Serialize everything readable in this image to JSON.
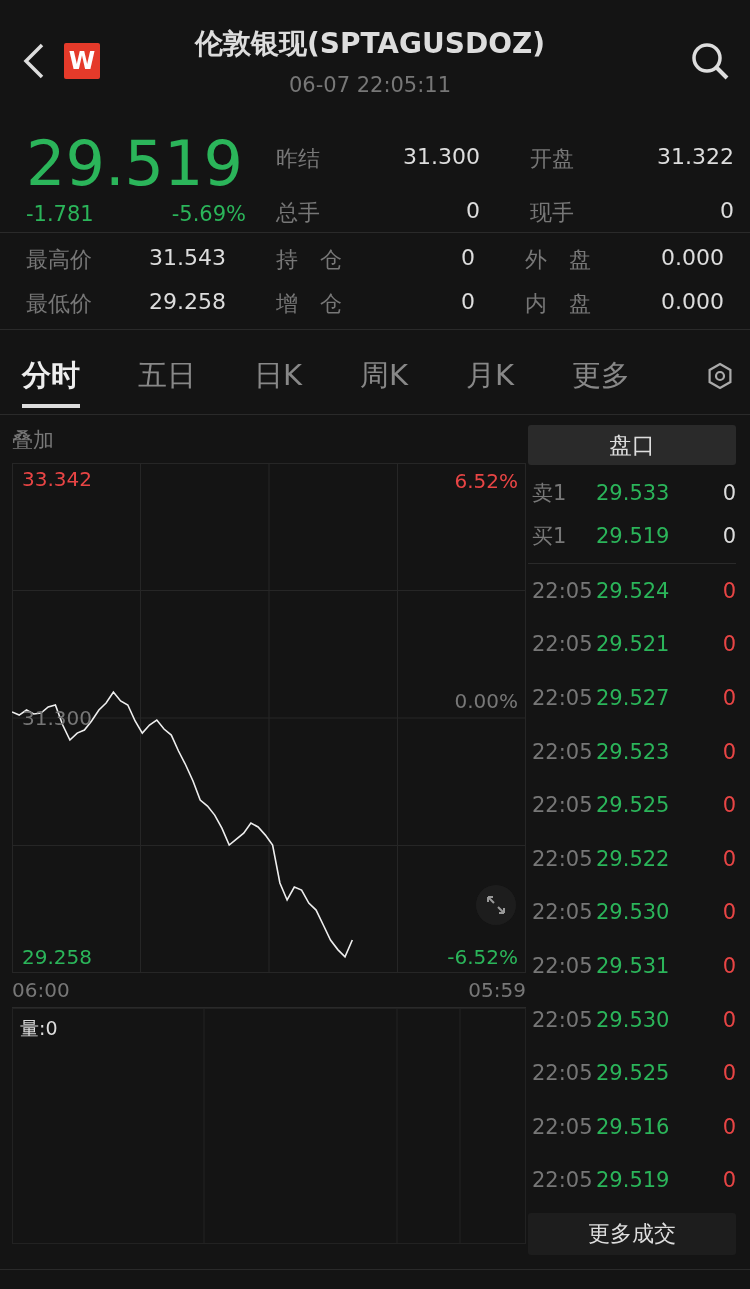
{
  "header": {
    "title": "伦敦银现(SPTAGUSDOZ)",
    "time": "06-07 22:05:11",
    "badge": "W"
  },
  "quote": {
    "price": "29.519",
    "change": "-1.781",
    "change_pct": "-5.69%"
  },
  "stats_top": [
    [
      {
        "label": "昨结",
        "value": "31.300"
      },
      {
        "label": "开盘",
        "value": "31.322"
      }
    ],
    [
      {
        "label": "总手",
        "value": "0"
      },
      {
        "label": "现手",
        "value": "0"
      }
    ]
  ],
  "stats_bottom": [
    [
      {
        "label": "最高价",
        "value": "31.543"
      },
      {
        "label": "持　仓",
        "value": "0"
      },
      {
        "label": "外　盘",
        "value": "0.000"
      }
    ],
    [
      {
        "label": "最低价",
        "value": "29.258"
      },
      {
        "label": "增　仓",
        "value": "0"
      },
      {
        "label": "内　盘",
        "value": "0.000"
      }
    ]
  ],
  "tabs": [
    {
      "label": "分时",
      "selected": true
    },
    {
      "label": "五日",
      "selected": false
    },
    {
      "label": "日K",
      "selected": false
    },
    {
      "label": "周K",
      "selected": false
    },
    {
      "label": "月K",
      "selected": false
    },
    {
      "label": "更多",
      "selected": false
    }
  ],
  "chart": {
    "overlay_label": "叠加",
    "y_top_pct": "6.52%",
    "y_mid_pct": "0.00%",
    "y_bottom_pct": "-6.52%",
    "volume_label": "量:0",
    "x_start": "06:00",
    "x_end": "05:59",
    "chart_data": {
      "type": "line",
      "ylim": [
        29.12,
        33.48
      ],
      "categories": [
        null,
        null,
        null,
        null,
        null,
        null,
        null,
        null,
        null,
        null,
        null,
        null,
        null,
        null,
        null,
        null,
        null,
        null,
        null,
        null,
        null,
        null,
        null,
        null,
        null,
        null,
        null,
        null,
        null,
        null,
        null,
        null,
        null,
        null,
        null,
        null,
        null,
        null,
        null,
        null,
        null,
        null,
        null,
        null,
        null,
        null,
        null,
        null,
        null,
        null,
        null,
        null,
        null,
        null,
        null,
        null,
        null,
        null,
        null,
        null,
        null,
        null,
        null,
        null,
        null,
        null,
        null,
        null,
        null,
        null,
        null,
        null
      ],
      "yticks": [
        {
          "value": 33.342,
          "label": "33.342"
        },
        {
          "value": 31.3,
          "label": "31.300"
        },
        {
          "value": 29.258,
          "label": "29.258"
        }
      ],
      "series": [
        {
          "color": "#eeeeee",
          "values": [
            31.351,
            31.325,
            31.368,
            31.334,
            31.342,
            31.394,
            31.411,
            31.24,
            31.112,
            31.171,
            31.197,
            31.274,
            31.368,
            31.428,
            31.522,
            31.445,
            31.411,
            31.274,
            31.171,
            31.24,
            31.283,
            31.206,
            31.154,
            31.018,
            30.898,
            30.761,
            30.599,
            30.547,
            30.47,
            30.359,
            30.214,
            30.265,
            30.316,
            30.402,
            30.368,
            30.299,
            30.214,
            29.889,
            29.744,
            29.855,
            29.829,
            29.718,
            29.658,
            29.53,
            29.402,
            29.32,
            29.258,
            29.402,
            null,
            null,
            null,
            null,
            null,
            null,
            null,
            null,
            null,
            null,
            null,
            null,
            null,
            null,
            null,
            null,
            null,
            null,
            null,
            null,
            null,
            null,
            null,
            null
          ]
        }
      ]
    }
  },
  "panel": {
    "title": "盘口",
    "book": [
      {
        "label": "卖1",
        "price": "29.533",
        "qty": "0"
      },
      {
        "label": "买1",
        "price": "29.519",
        "qty": "0"
      }
    ],
    "trades": [
      {
        "time": "22:05",
        "price": "29.524",
        "qty": "0"
      },
      {
        "time": "22:05",
        "price": "29.521",
        "qty": "0"
      },
      {
        "time": "22:05",
        "price": "29.527",
        "qty": "0"
      },
      {
        "time": "22:05",
        "price": "29.523",
        "qty": "0"
      },
      {
        "time": "22:05",
        "price": "29.525",
        "qty": "0"
      },
      {
        "time": "22:05",
        "price": "29.522",
        "qty": "0"
      },
      {
        "time": "22:05",
        "price": "29.530",
        "qty": "0"
      },
      {
        "time": "22:05",
        "price": "29.531",
        "qty": "0"
      },
      {
        "time": "22:05",
        "price": "29.530",
        "qty": "0"
      },
      {
        "time": "22:05",
        "price": "29.525",
        "qty": "0"
      },
      {
        "time": "22:05",
        "price": "29.516",
        "qty": "0"
      },
      {
        "time": "22:05",
        "price": "29.519",
        "qty": "0"
      }
    ],
    "more_button": "更多成交"
  }
}
